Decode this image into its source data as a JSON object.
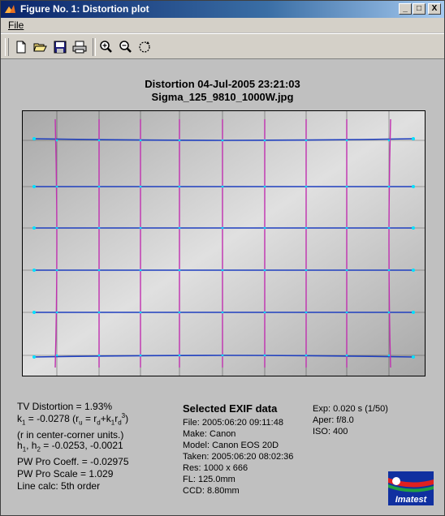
{
  "window": {
    "title": "Figure No. 1: Distortion plot",
    "controls": {
      "minimize": "_",
      "maximize": "□",
      "close": "X"
    }
  },
  "menu": {
    "file": "File"
  },
  "toolbar": {
    "buttons": [
      "new-document-icon",
      "open-folder-icon",
      "save-disk-icon",
      "print-icon",
      "zoom-in-icon",
      "zoom-out-icon",
      "rotate-icon"
    ]
  },
  "plot": {
    "title_line1": "Distortion  04-Jul-2005 23:21:03",
    "title_line2": "Sigma_125_9810_1000W.jpg"
  },
  "results": {
    "tv_distortion": "TV Distortion = 1.93%",
    "k1_line": "k1 = -0.0278  (ru = rd+k1rd3)",
    "units_note": "(r in center-corner units.)",
    "h_line": "h1, h2 = -0.0253, -0.0021",
    "pw_coeff": "PW Pro Coeff. = -0.02975",
    "pw_scale": "PW Pro Scale = 1.029",
    "line_calc": "Line calc: 5th order"
  },
  "exif": {
    "heading": "Selected EXIF data",
    "file": "File:  2005:06:20 09:11:48",
    "make": "Make:  Canon",
    "model": "Model: Canon EOS 20D",
    "taken": "Taken: 2005:06:20 08:02:36",
    "res": "Res:   1000 x 666",
    "fl": "FL:   125.0mm",
    "ccd": "CCD:  8.80mm",
    "exp": "Exp:  0.020 s  (1/50)",
    "aper": "Aper:  f/8.0",
    "iso": "ISO:    400"
  },
  "logo": {
    "text": "Imatest"
  },
  "colors": {
    "title_bar_start": "#0a246a",
    "horizontal_lines": "#1f3fbf",
    "vertical_lines": "#c030b0",
    "points": "#00e0ff",
    "reference_grid": "#303030"
  }
}
